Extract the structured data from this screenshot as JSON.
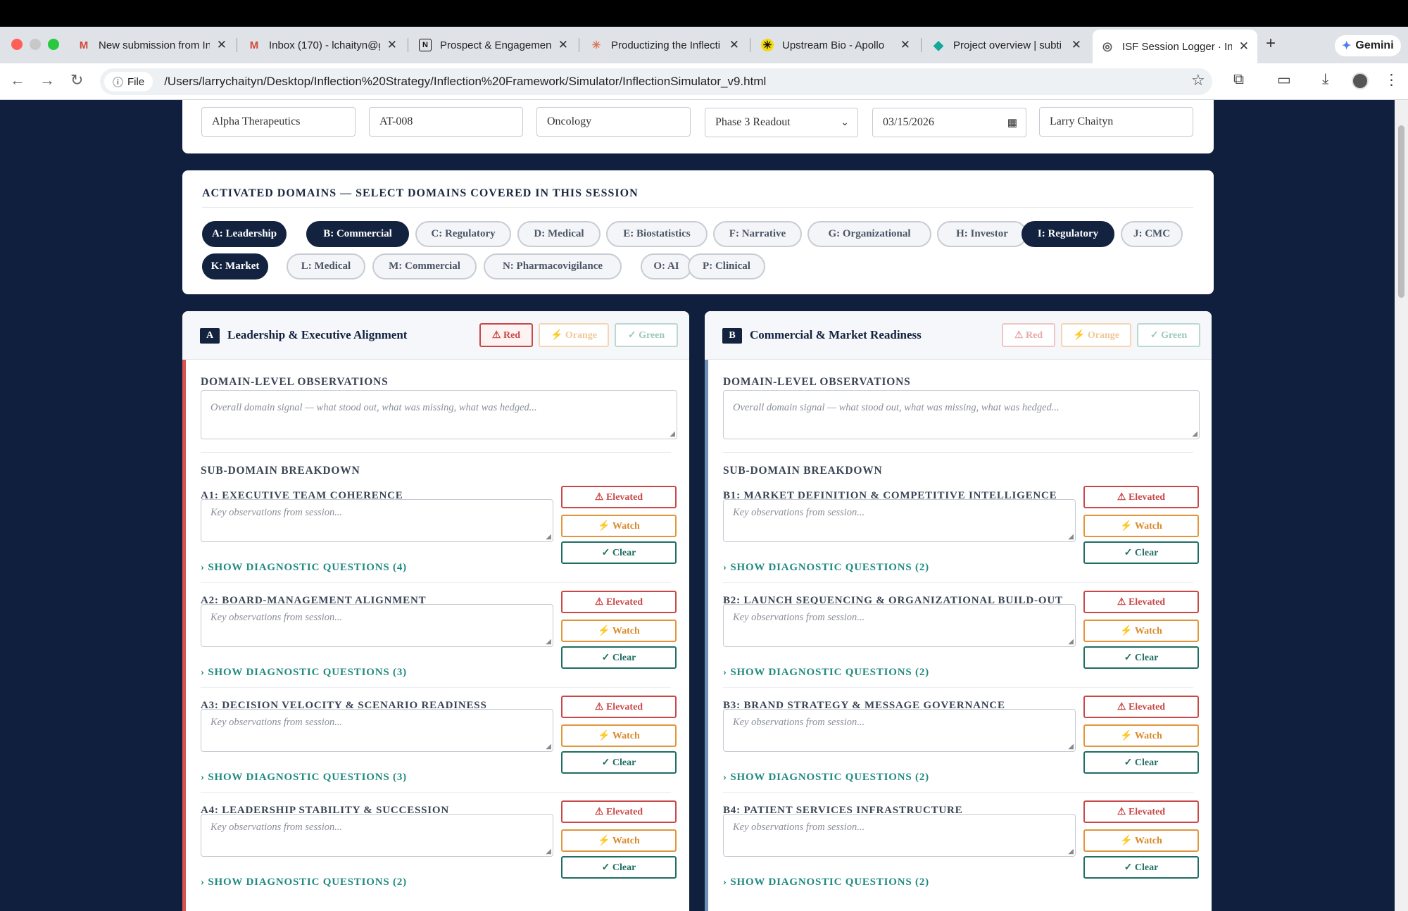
{
  "browser": {
    "tabs": [
      {
        "title": "New submission from In",
        "icon": "gmail-icon"
      },
      {
        "title": "Inbox (170) - lchaityn@g",
        "icon": "gmail-icon"
      },
      {
        "title": "Prospect & Engagement",
        "icon": "notion-icon"
      },
      {
        "title": "Productizing the Inflecti",
        "icon": "claude-icon"
      },
      {
        "title": "Upstream Bio - Apollo",
        "icon": "apollo-icon"
      },
      {
        "title": "Project overview | subti",
        "icon": "diamond-icon"
      },
      {
        "title": "ISF Session Logger · Inf",
        "icon": "globe-icon",
        "active": true
      }
    ],
    "gemini_label": "Gemini",
    "file_chip": "File",
    "url": "/Users/larrychaityn/Desktop/Inflection%20Strategy/Inflection%20Framework/Simulator/InflectionSimulator_v9.html"
  },
  "session": {
    "company": "Alpha Therapeutics",
    "asset": "AT-008",
    "therapeutic_area": "Oncology",
    "inflection": "Phase 3 Readout",
    "date": "03/15/2026",
    "facilitator": "Larry Chaityn"
  },
  "domains": {
    "title": "ACTIVATED DOMAINS — SELECT DOMAINS COVERED IN THIS SESSION",
    "pills": [
      {
        "label": "A: Leadership",
        "active": true
      },
      {
        "label": "B: Commercial",
        "active": true
      },
      {
        "label": "C: Regulatory",
        "active": false
      },
      {
        "label": "D: Medical",
        "active": false
      },
      {
        "label": "E: Biostatistics",
        "active": false
      },
      {
        "label": "F: Narrative",
        "active": false
      },
      {
        "label": "G: Organizational",
        "active": false
      },
      {
        "label": "H: Investor",
        "active": false
      },
      {
        "label": "I: Regulatory",
        "active": true
      },
      {
        "label": "J: CMC",
        "active": false
      },
      {
        "label": "K: Market",
        "active": true
      },
      {
        "label": "L: Medical",
        "active": false
      },
      {
        "label": "M: Commercial",
        "active": false
      },
      {
        "label": "N: Pharmacovigilance",
        "active": false
      },
      {
        "label": "O: AI",
        "active": false
      },
      {
        "label": "P: Clinical",
        "active": false
      }
    ]
  },
  "rating_labels": {
    "red": "⚠ Red",
    "orange": "⚡ Orange",
    "green": "✓ Green"
  },
  "status_labels": {
    "elevated": "⚠ Elevated",
    "watch": "⚡ Watch",
    "clear": "✓ Clear"
  },
  "panel_labels": {
    "observations": "DOMAIN-LEVEL OBSERVATIONS",
    "observations_placeholder": "Overall domain signal — what stood out, what was missing, what was hedged...",
    "breakdown": "SUB-DOMAIN BREAKDOWN",
    "sub_placeholder": "Key observations from session..."
  },
  "panels": [
    {
      "letter": "A",
      "title": "Leadership & Executive Alignment",
      "rating": "red",
      "accent": "#d9534f",
      "subdomains": [
        {
          "label": "A1: EXECUTIVE TEAM COHERENCE",
          "questions": "SHOW DIAGNOSTIC QUESTIONS (4)"
        },
        {
          "label": "A2: BOARD-MANAGEMENT ALIGNMENT",
          "questions": "SHOW DIAGNOSTIC QUESTIONS (3)"
        },
        {
          "label": "A3: DECISION VELOCITY & SCENARIO READINESS",
          "questions": "SHOW DIAGNOSTIC QUESTIONS (3)"
        },
        {
          "label": "A4: LEADERSHIP STABILITY & SUCCESSION",
          "questions": "SHOW DIAGNOSTIC QUESTIONS (2)"
        }
      ]
    },
    {
      "letter": "B",
      "title": "Commercial & Market Readiness",
      "rating": "none",
      "accent": "#6f8fb8",
      "subdomains": [
        {
          "label": "B1: MARKET DEFINITION & COMPETITIVE INTELLIGENCE",
          "questions": "SHOW DIAGNOSTIC QUESTIONS (2)"
        },
        {
          "label": "B2: LAUNCH SEQUENCING & ORGANIZATIONAL BUILD-OUT",
          "questions": "SHOW DIAGNOSTIC QUESTIONS (2)"
        },
        {
          "label": "B3: BRAND STRATEGY & MESSAGE GOVERNANCE",
          "questions": "SHOW DIAGNOSTIC QUESTIONS (2)"
        },
        {
          "label": "B4: PATIENT SERVICES INFRASTRUCTURE",
          "questions": "SHOW DIAGNOSTIC QUESTIONS (2)"
        }
      ]
    }
  ]
}
